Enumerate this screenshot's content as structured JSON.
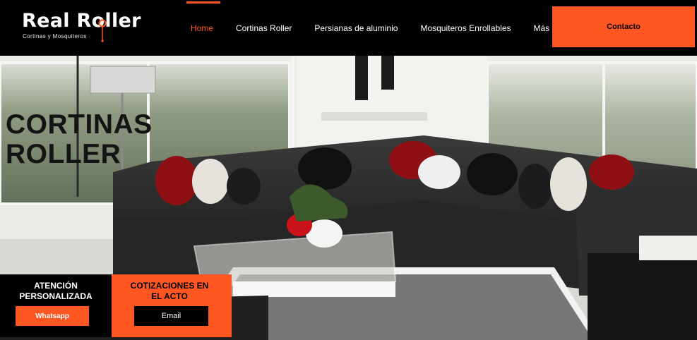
{
  "brand": {
    "name": "Real Roller",
    "tagline": "Cortinas y Mosquiteros",
    "accent": "#ff5722",
    "header_bg": "#000000"
  },
  "nav": {
    "items": [
      {
        "label": "Home",
        "active": true
      },
      {
        "label": "Cortinas Roller",
        "active": false
      },
      {
        "label": "Persianas de aluminio",
        "active": false
      },
      {
        "label": "Mosquiteros Enrollables",
        "active": false
      },
      {
        "label": "Más",
        "active": false
      }
    ]
  },
  "header": {
    "contact_label": "Contacto"
  },
  "hero": {
    "title": "CORTINAS\nROLLER",
    "image": "living-room-sofa-photo"
  },
  "cards": {
    "attention": {
      "title": "ATENCIÓN\nPERSONALIZADA",
      "button_label": "Whatsapp"
    },
    "quotes": {
      "title": "COTIZACIONES EN\nEL ACTO",
      "button_label": "Email"
    }
  }
}
